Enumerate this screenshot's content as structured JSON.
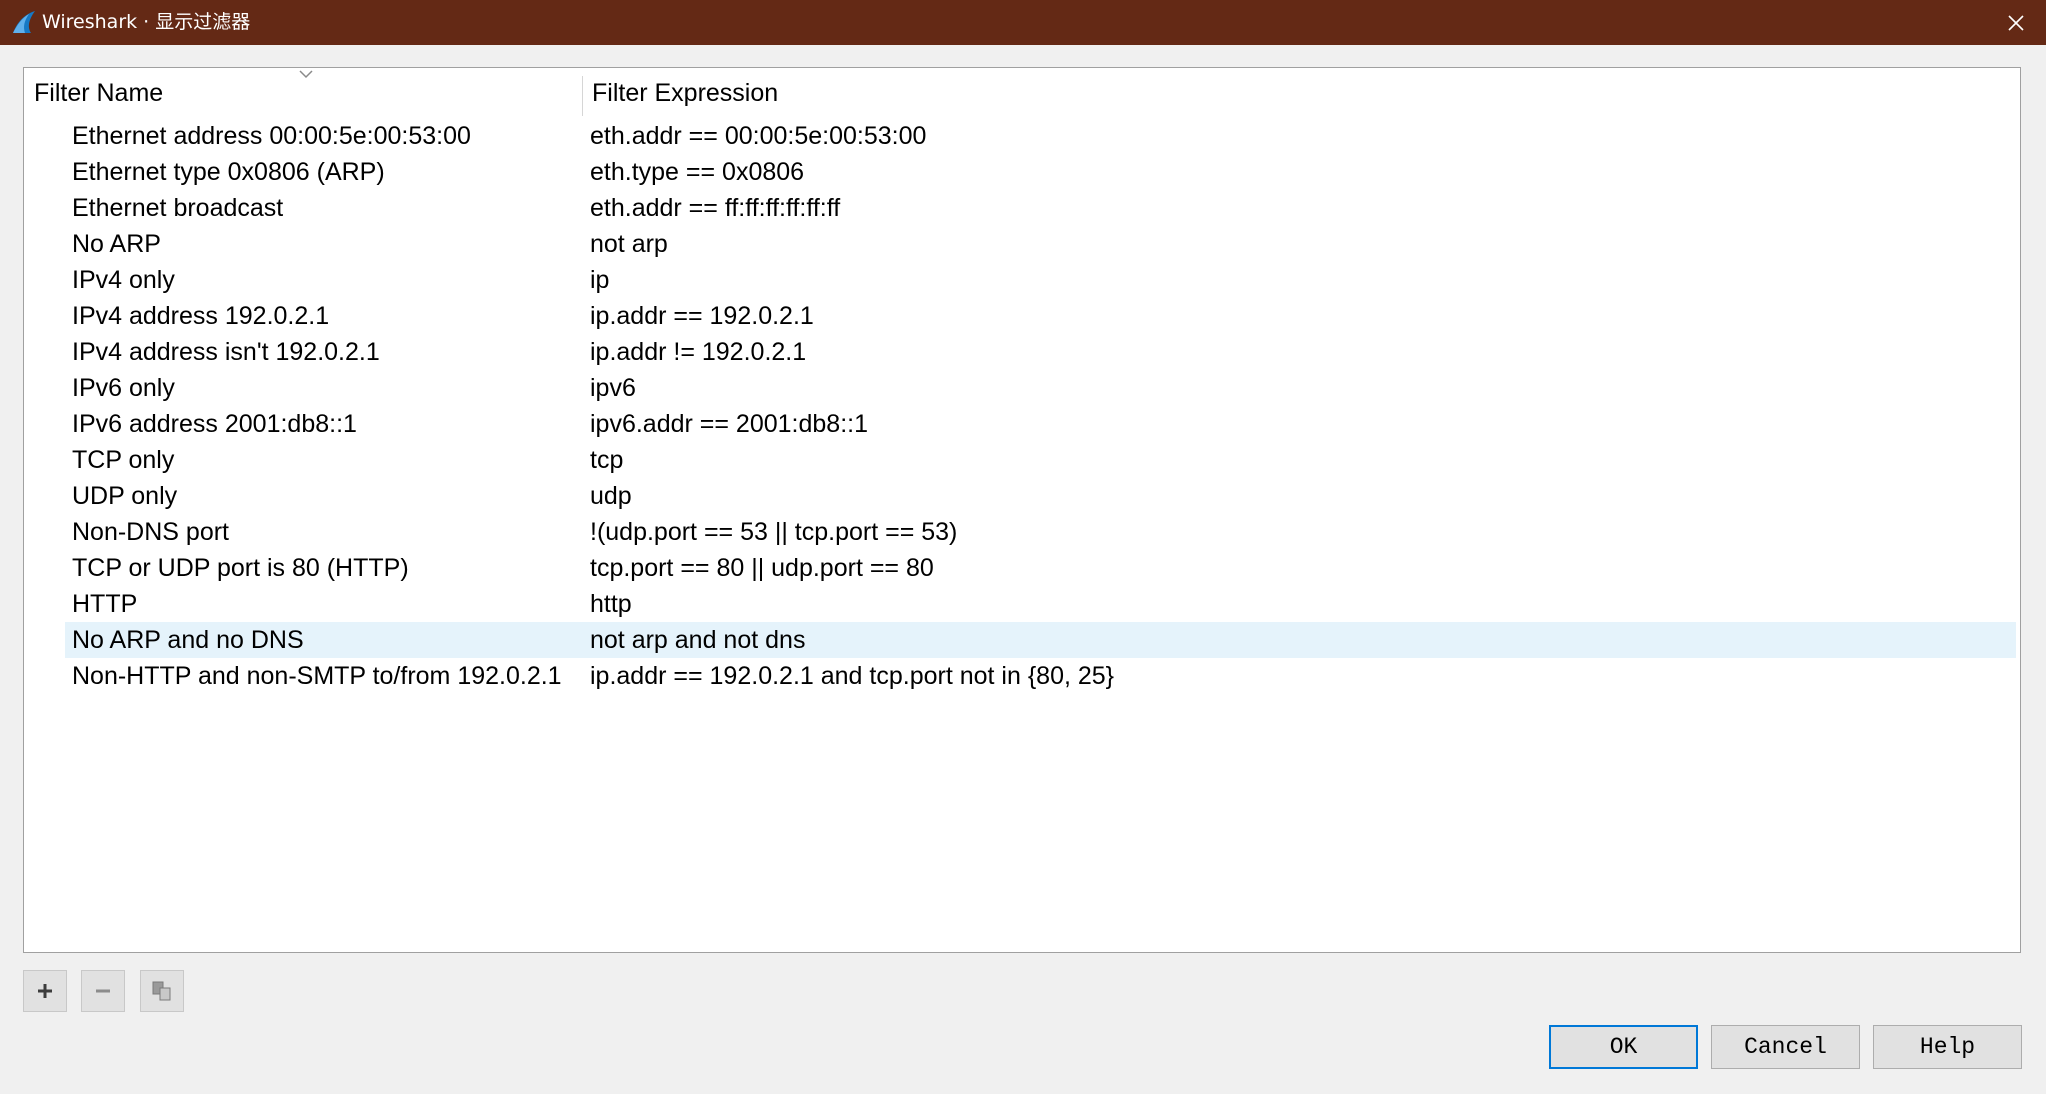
{
  "window": {
    "title": "Wireshark · 显示过滤器",
    "close_glyph": "✕"
  },
  "table": {
    "columns": [
      "Filter Name",
      "Filter Expression"
    ],
    "sort_indicator": "descending",
    "rows": [
      {
        "name": "Ethernet address 00:00:5e:00:53:00",
        "expr": "eth.addr == 00:00:5e:00:53:00",
        "selected": false
      },
      {
        "name": "Ethernet type 0x0806 (ARP)",
        "expr": "eth.type == 0x0806",
        "selected": false
      },
      {
        "name": "Ethernet broadcast",
        "expr": "eth.addr == ff:ff:ff:ff:ff:ff",
        "selected": false
      },
      {
        "name": "No ARP",
        "expr": "not arp",
        "selected": false
      },
      {
        "name": "IPv4 only",
        "expr": "ip",
        "selected": false
      },
      {
        "name": "IPv4 address 192.0.2.1",
        "expr": "ip.addr == 192.0.2.1",
        "selected": false
      },
      {
        "name": "IPv4 address isn't 192.0.2.1",
        "expr": "ip.addr != 192.0.2.1",
        "selected": false
      },
      {
        "name": "IPv6 only",
        "expr": "ipv6",
        "selected": false
      },
      {
        "name": "IPv6 address 2001:db8::1",
        "expr": "ipv6.addr == 2001:db8::1",
        "selected": false
      },
      {
        "name": "TCP only",
        "expr": "tcp",
        "selected": false
      },
      {
        "name": "UDP only",
        "expr": "udp",
        "selected": false
      },
      {
        "name": "Non-DNS port",
        "expr": "!(udp.port == 53 || tcp.port == 53)",
        "selected": false
      },
      {
        "name": "TCP or UDP port is 80 (HTTP)",
        "expr": "tcp.port == 80 || udp.port == 80",
        "selected": false
      },
      {
        "name": "HTTP",
        "expr": "http",
        "selected": false
      },
      {
        "name": "No ARP and no DNS",
        "expr": "not arp and not dns",
        "selected": true
      },
      {
        "name": "Non-HTTP and non-SMTP to/from 192.0.2.1",
        "expr": "ip.addr == 192.0.2.1 and tcp.port not in {80, 25}",
        "selected": false
      }
    ]
  },
  "toolbar": {
    "add_icon": "plus-icon",
    "remove_icon": "minus-icon",
    "copy_icon": "copy-icon"
  },
  "buttons": {
    "ok": "OK",
    "cancel": "Cancel",
    "help": "Help"
  },
  "colors": {
    "titlebar": "#642915",
    "selection": "#e5f3fb",
    "default_button_border": "#0078d7"
  }
}
